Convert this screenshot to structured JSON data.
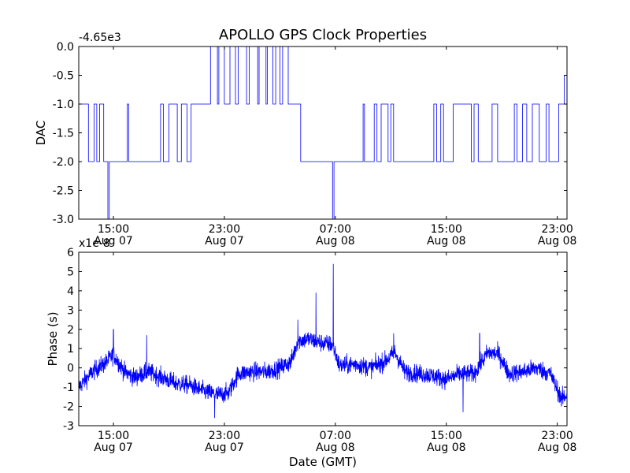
{
  "chart_data": {
    "title": "APOLLO GPS Clock Properties",
    "xlabel": "Date (GMT)",
    "x_ticks": [
      {
        "time": "15:00",
        "date": "Aug 07",
        "hours": 15
      },
      {
        "time": "23:00",
        "date": "Aug 07",
        "hours": 23
      },
      {
        "time": "07:00",
        "date": "Aug 08",
        "hours": 31
      },
      {
        "time": "15:00",
        "date": "Aug 08",
        "hours": 39
      },
      {
        "time": "23:00",
        "date": "Aug 08",
        "hours": 47
      }
    ],
    "xlim_hours": [
      12.5,
      47.7
    ],
    "panels": [
      {
        "type": "line",
        "ylabel": "DAC",
        "offset_label": "-4.65e3",
        "ylim": [
          -3.0,
          0.0
        ],
        "yticks": [
          0.0,
          -0.5,
          -1.0,
          -1.5,
          -2.0,
          -2.5,
          -3.0
        ],
        "ytick_labels": [
          "0.0",
          "-0.5",
          "-1.0",
          "-1.5",
          "-2.0",
          "-2.5",
          "-3.0"
        ],
        "color": "#0000ff",
        "segments": [
          {
            "t": 12.5,
            "v": -1
          },
          {
            "t": 13.2,
            "v": -2
          },
          {
            "t": 13.6,
            "v": -1
          },
          {
            "t": 13.8,
            "v": -2
          },
          {
            "t": 14.0,
            "v": -1
          },
          {
            "t": 14.3,
            "v": -2
          },
          {
            "t": 14.6,
            "v": -3
          },
          {
            "t": 14.7,
            "v": -2
          },
          {
            "t": 16.0,
            "v": -1
          },
          {
            "t": 16.1,
            "v": -2
          },
          {
            "t": 18.4,
            "v": -1
          },
          {
            "t": 18.6,
            "v": -2
          },
          {
            "t": 19.0,
            "v": -1
          },
          {
            "t": 19.6,
            "v": -2
          },
          {
            "t": 19.9,
            "v": -1
          },
          {
            "t": 20.3,
            "v": -2
          },
          {
            "t": 20.6,
            "v": -1
          },
          {
            "t": 21.1,
            "v": -1
          },
          {
            "t": 22.0,
            "v": 0
          },
          {
            "t": 22.5,
            "v": -1
          },
          {
            "t": 22.6,
            "v": 0
          },
          {
            "t": 23.0,
            "v": -1
          },
          {
            "t": 23.4,
            "v": 0
          },
          {
            "t": 23.8,
            "v": -1
          },
          {
            "t": 24.0,
            "v": 0
          },
          {
            "t": 24.6,
            "v": -1
          },
          {
            "t": 24.8,
            "v": 0
          },
          {
            "t": 25.4,
            "v": -1
          },
          {
            "t": 25.5,
            "v": 0
          },
          {
            "t": 26.0,
            "v": -1
          },
          {
            "t": 26.1,
            "v": 0
          },
          {
            "t": 26.5,
            "v": -1
          },
          {
            "t": 26.7,
            "v": 0
          },
          {
            "t": 27.0,
            "v": -1
          },
          {
            "t": 27.2,
            "v": 0
          },
          {
            "t": 27.6,
            "v": -1
          },
          {
            "t": 28.5,
            "v": -2
          },
          {
            "t": 30.8,
            "v": -3
          },
          {
            "t": 30.9,
            "v": -2
          },
          {
            "t": 33.0,
            "v": -1
          },
          {
            "t": 33.1,
            "v": -2
          },
          {
            "t": 33.8,
            "v": -1
          },
          {
            "t": 34.0,
            "v": -2
          },
          {
            "t": 34.3,
            "v": -1
          },
          {
            "t": 34.8,
            "v": -2
          },
          {
            "t": 35.0,
            "v": -1
          },
          {
            "t": 35.2,
            "v": -2
          },
          {
            "t": 38.1,
            "v": -1
          },
          {
            "t": 38.3,
            "v": -2
          },
          {
            "t": 38.6,
            "v": -1
          },
          {
            "t": 38.8,
            "v": -2
          },
          {
            "t": 39.5,
            "v": -1
          },
          {
            "t": 40.8,
            "v": -2
          },
          {
            "t": 41.0,
            "v": -1
          },
          {
            "t": 41.3,
            "v": -2
          },
          {
            "t": 42.3,
            "v": -1
          },
          {
            "t": 42.7,
            "v": -2
          },
          {
            "t": 43.9,
            "v": -1
          },
          {
            "t": 44.1,
            "v": -2
          },
          {
            "t": 44.5,
            "v": -1
          },
          {
            "t": 44.8,
            "v": -2
          },
          {
            "t": 45.2,
            "v": -1
          },
          {
            "t": 45.7,
            "v": -2
          },
          {
            "t": 46.2,
            "v": -1
          },
          {
            "t": 46.4,
            "v": -2
          },
          {
            "t": 47.1,
            "v": -1
          },
          {
            "t": 47.5,
            "v": -0.5
          },
          {
            "t": 47.7,
            "v": -1
          }
        ]
      },
      {
        "type": "line",
        "ylabel": "Phase (s)",
        "offset_label": "x1e-8",
        "ylim": [
          -3,
          6
        ],
        "yticks": [
          6,
          5,
          4,
          3,
          2,
          1,
          0,
          -1,
          -2,
          -3
        ],
        "ytick_labels": [
          "6",
          "5",
          "4",
          "3",
          "2",
          "1",
          "0",
          "-1",
          "-2",
          "-3"
        ],
        "color": "#0000ff",
        "trend": [
          {
            "t": 12.5,
            "v": -1.0
          },
          {
            "t": 13.5,
            "v": -0.2
          },
          {
            "t": 14.5,
            "v": 0.3
          },
          {
            "t": 15.0,
            "v": 0.7
          },
          {
            "t": 15.8,
            "v": -0.2
          },
          {
            "t": 16.5,
            "v": -0.5
          },
          {
            "t": 17.5,
            "v": -0.2
          },
          {
            "t": 18.5,
            "v": -0.5
          },
          {
            "t": 19.5,
            "v": -0.8
          },
          {
            "t": 20.5,
            "v": -0.9
          },
          {
            "t": 21.5,
            "v": -1.2
          },
          {
            "t": 22.5,
            "v": -1.4
          },
          {
            "t": 23.3,
            "v": -1.3
          },
          {
            "t": 24.0,
            "v": -0.3
          },
          {
            "t": 25.0,
            "v": -0.2
          },
          {
            "t": 26.0,
            "v": -0.2
          },
          {
            "t": 27.0,
            "v": 0.0
          },
          {
            "t": 27.8,
            "v": 0.3
          },
          {
            "t": 28.3,
            "v": 1.4
          },
          {
            "t": 29.0,
            "v": 1.5
          },
          {
            "t": 30.0,
            "v": 1.3
          },
          {
            "t": 30.8,
            "v": 1.2
          },
          {
            "t": 31.3,
            "v": 0.1
          },
          {
            "t": 32.5,
            "v": 0.2
          },
          {
            "t": 33.5,
            "v": 0.0
          },
          {
            "t": 34.5,
            "v": 0.3
          },
          {
            "t": 35.3,
            "v": 0.8
          },
          {
            "t": 36.0,
            "v": -0.2
          },
          {
            "t": 37.0,
            "v": -0.3
          },
          {
            "t": 38.0,
            "v": -0.4
          },
          {
            "t": 39.0,
            "v": -0.6
          },
          {
            "t": 40.0,
            "v": -0.3
          },
          {
            "t": 41.0,
            "v": -0.3
          },
          {
            "t": 42.0,
            "v": 0.8
          },
          {
            "t": 42.8,
            "v": 0.7
          },
          {
            "t": 43.5,
            "v": -0.3
          },
          {
            "t": 44.5,
            "v": -0.2
          },
          {
            "t": 45.5,
            "v": 0.0
          },
          {
            "t": 46.5,
            "v": -0.3
          },
          {
            "t": 47.3,
            "v": -1.6
          },
          {
            "t": 47.7,
            "v": -1.4
          }
        ],
        "spikes": [
          {
            "t": 30.85,
            "v": 5.4
          },
          {
            "t": 29.6,
            "v": 3.9
          },
          {
            "t": 28.3,
            "v": 2.5
          },
          {
            "t": 15.0,
            "v": 2.0
          },
          {
            "t": 17.4,
            "v": 1.7
          },
          {
            "t": 35.2,
            "v": 1.8
          },
          {
            "t": 41.4,
            "v": 1.8
          },
          {
            "t": 22.3,
            "v": -2.6
          },
          {
            "t": 40.2,
            "v": -2.3
          },
          {
            "t": 47.3,
            "v": -2.0
          }
        ]
      }
    ]
  }
}
